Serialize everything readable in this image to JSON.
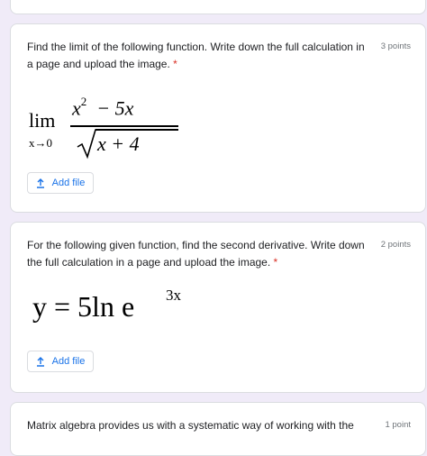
{
  "questions": [
    {
      "text": "Find the limit of the following function. Write down the full calculation in a page and upload the image.",
      "required_mark": "*",
      "points": "3 points",
      "math": {
        "operator": "lim",
        "subscript": "x→0",
        "numerator": "x",
        "numerator_power": "2",
        "numerator_rest": " − 5x",
        "denominator": "x + 4"
      },
      "upload_label": "Add file",
      "upload_icon": "upload-icon"
    },
    {
      "text": "For the following given function, find the second derivative. Write down the full calculation in a page and upload the image.",
      "required_mark": "*",
      "points": "2 points",
      "math": {
        "equation": "y = 5ln e",
        "exponent": "3x"
      },
      "upload_label": "Add file",
      "upload_icon": "upload-icon"
    },
    {
      "text": "Matrix algebra provides us with a systematic way of working with the",
      "points": "1 point"
    }
  ],
  "colors": {
    "background": "#f0ebf8",
    "accent": "#1a73e8",
    "required": "#d93025"
  }
}
